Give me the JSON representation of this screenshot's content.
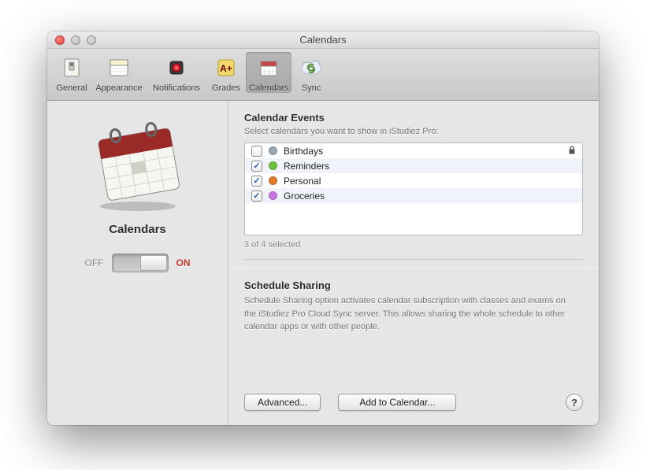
{
  "window": {
    "title": "Calendars"
  },
  "toolbar": {
    "items": [
      {
        "label": "General"
      },
      {
        "label": "Appearance"
      },
      {
        "label": "Notifications"
      },
      {
        "label": "Grades"
      },
      {
        "label": "Calendars"
      },
      {
        "label": "Sync"
      }
    ],
    "selected_index": 4
  },
  "side": {
    "title": "Calendars",
    "toggle": {
      "off_label": "OFF",
      "on_label": "ON",
      "value": "on"
    }
  },
  "events": {
    "title": "Calendar Events",
    "subtitle": "Select calendars you want to show in iStudiez Pro:",
    "items": [
      {
        "name": "Birthdays",
        "checked": false,
        "color": "#9aa7b3",
        "locked": true
      },
      {
        "name": "Reminders",
        "checked": true,
        "color": "#6fbf3f",
        "locked": false
      },
      {
        "name": "Personal",
        "checked": true,
        "color": "#e27a2c",
        "locked": false
      },
      {
        "name": "Groceries",
        "checked": true,
        "color": "#c977e0",
        "locked": false
      }
    ],
    "count_text": "3 of 4 selected"
  },
  "sharing": {
    "title": "Schedule Sharing",
    "desc": "Schedule Sharing option activates calendar subscription with classes and exams on the iStudiez Pro Cloud Sync server. This allows sharing the whole schedule to other calendar apps or with other people."
  },
  "buttons": {
    "advanced": "Advanced...",
    "add": "Add to Calendar...",
    "help": "?"
  }
}
